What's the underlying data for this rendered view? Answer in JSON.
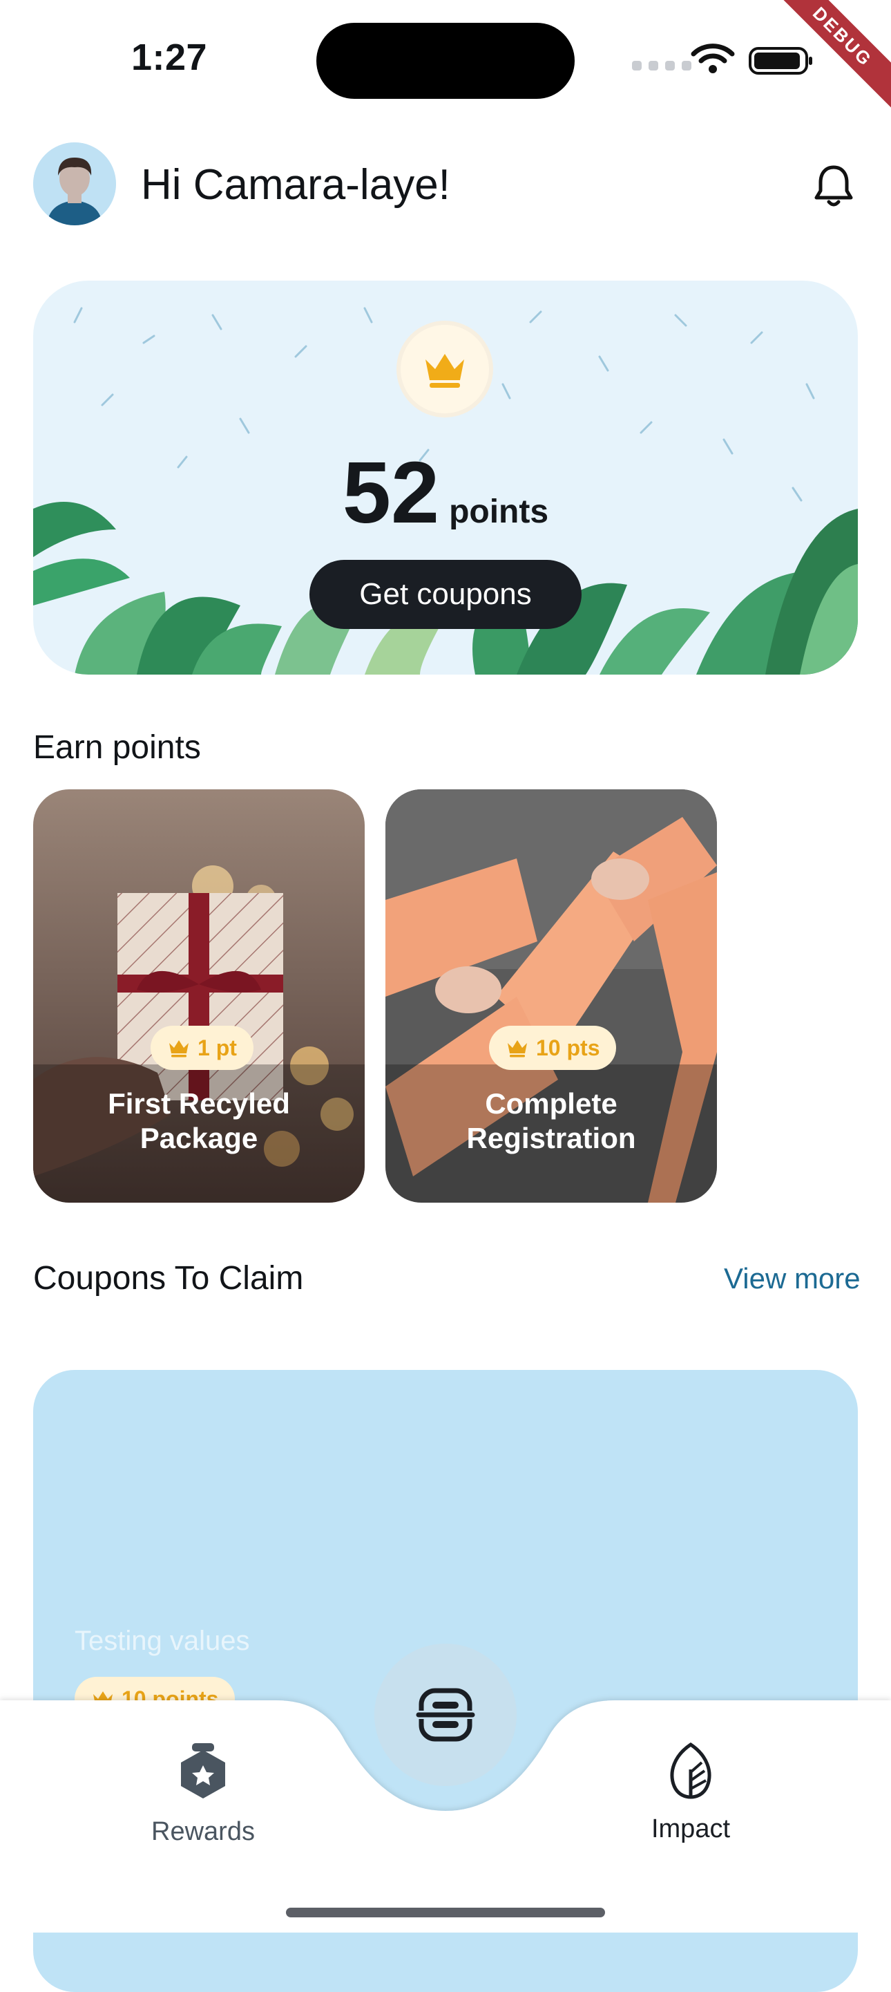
{
  "status_bar": {
    "time": "1:27",
    "debug_label": "DEBUG"
  },
  "header": {
    "greeting": "Hi Camara-laye!"
  },
  "hero": {
    "points_value": "52",
    "points_label": "points",
    "button_label": "Get coupons"
  },
  "earn": {
    "title": "Earn points",
    "cards": [
      {
        "points": "1 pt",
        "title_line1": "First Recyled",
        "title_line2": "Package"
      },
      {
        "points": "10 pts",
        "title_line1": "Complete",
        "title_line2": "Registration"
      }
    ]
  },
  "coupons": {
    "title": "Coupons To Claim",
    "view_more": "View more",
    "card": {
      "name": "Testing values",
      "points": "10 points"
    }
  },
  "nav": {
    "items": [
      {
        "label": "Rewards",
        "icon": "rewards-hexagon-icon"
      },
      {
        "label": "",
        "icon": "scan-icon"
      },
      {
        "label": "Impact",
        "icon": "leaf-icon"
      }
    ]
  },
  "colors": {
    "accent_dark": "#1a1e24",
    "badge_gold": "#e8a317",
    "link_blue": "#1c6a93",
    "coupon_card": "#bfe3f6"
  }
}
